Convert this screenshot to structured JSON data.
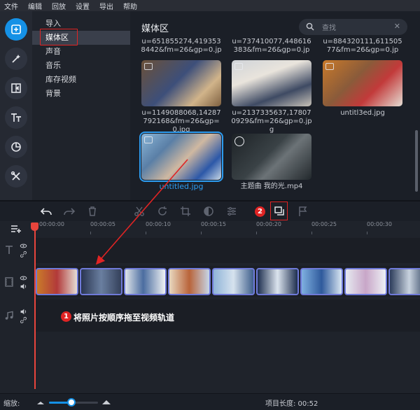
{
  "menu": [
    "文件",
    "编辑",
    "回放",
    "设置",
    "导出",
    "帮助"
  ],
  "categories": [
    {
      "label": "导入",
      "selected": false
    },
    {
      "label": "媒体区",
      "selected": true
    },
    {
      "label": "声音",
      "selected": false
    },
    {
      "label": "音乐",
      "selected": false
    },
    {
      "label": "库存视频",
      "selected": false
    },
    {
      "label": "背景",
      "selected": false
    }
  ],
  "media": {
    "title": "媒体区",
    "search_placeholder": "查找",
    "items": [
      {
        "name": "u=651855274,4193538442&fm=26&gp=0.jp",
        "kind": "image"
      },
      {
        "name": "u=737410077,448616383&fm=26&gp=0.jp",
        "kind": "image"
      },
      {
        "name": "u=884320111,61150577&fm=26&gp=0.jp",
        "kind": "image"
      },
      {
        "name": "u=1149088068,14287792168&fm=26&gp=0.jpg",
        "kind": "image"
      },
      {
        "name": "u=2137335637,178070929&fm=26&gp=0.jpg",
        "kind": "image"
      },
      {
        "name": "untitl3ed.jpg",
        "kind": "image"
      },
      {
        "name": "untitled.jpg",
        "kind": "image",
        "selected": true
      },
      {
        "name": "主题曲 我的光.mp4",
        "kind": "video"
      }
    ]
  },
  "timeline": {
    "ticks": [
      "00:00:00",
      "00:00:05",
      "00:00:10",
      "00:00:15",
      "00:00:20",
      "00:00:25",
      "00:00:30"
    ],
    "clip_count": 10
  },
  "annotations": {
    "step1_number": "1",
    "step1_text": "将照片按顺序拖至视频轨道",
    "step2_number": "2"
  },
  "status": {
    "zoom_label": "缩放:",
    "zoom_level": 0.45,
    "duration_label": "项目长度: 00:52"
  },
  "colors": {
    "accent": "#1591e6",
    "annotation_red": "#e02424",
    "playhead": "#e8453c"
  }
}
